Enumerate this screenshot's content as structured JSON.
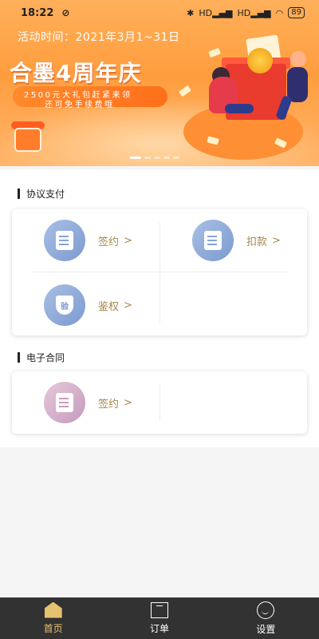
{
  "status_bar": {
    "time": "18:22",
    "battery": "89",
    "network_1": "HD",
    "network_2": "HD"
  },
  "banner": {
    "date_text": "活动时间：2021年3月1~31日",
    "title": "合墨4周年庆",
    "subtitle_line1": "2500元大礼包赶紧来领",
    "subtitle_line2": "还可免手续费哦",
    "slide_count": 5,
    "active_slide": 1
  },
  "sections": [
    {
      "title": "协议支付",
      "items": [
        {
          "label": "签约",
          "icon": "sign-doc-icon"
        },
        {
          "label": "扣款",
          "icon": "deduct-doc-icon"
        },
        {
          "label": "鉴权",
          "icon": "verify-shield-icon",
          "icon_text": "验"
        }
      ]
    },
    {
      "title": "电子合同",
      "items": [
        {
          "label": "签约",
          "icon": "contract-sign-icon"
        }
      ]
    }
  ],
  "chevron": ">",
  "bottom_nav": {
    "items": [
      {
        "label": "首页",
        "icon": "home-icon",
        "active": true
      },
      {
        "label": "订单",
        "icon": "order-icon",
        "active": false
      },
      {
        "label": "设置",
        "icon": "settings-icon",
        "active": false
      }
    ],
    "active_color": "#e7c271"
  },
  "colors": {
    "accent_gold": "#a8874f",
    "banner_orange": "#ff9d3e",
    "nav_bg": "#323232"
  }
}
